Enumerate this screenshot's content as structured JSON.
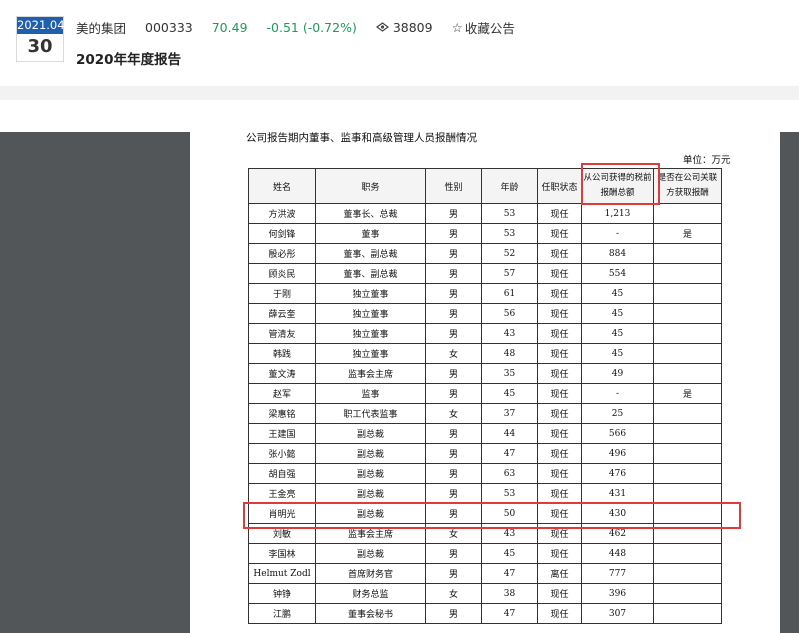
{
  "header": {
    "date_month": "2021.04",
    "date_day": "30",
    "company_name": "美的集团",
    "stock_code": "000333",
    "price": "70.49",
    "change": "-0.51 (-0.72%)",
    "views": "38809",
    "favorite_label": "收藏公告",
    "report_title": "2020年年度报告"
  },
  "document": {
    "caption": "公司报告期内董事、监事和高级管理人员报酬情况",
    "unit": "单位：万元",
    "columns": [
      "姓名",
      "职务",
      "性别",
      "年龄",
      "任职状态",
      "从公司获得的税前报酬总额",
      "是否在公司关联方获取报酬"
    ],
    "rows": [
      [
        "方洪波",
        "董事长、总裁",
        "男",
        "53",
        "现任",
        "1,213",
        ""
      ],
      [
        "何剑锋",
        "董事",
        "男",
        "53",
        "现任",
        "-",
        "是"
      ],
      [
        "殷必彤",
        "董事、副总裁",
        "男",
        "52",
        "现任",
        "884",
        ""
      ],
      [
        "顾炎民",
        "董事、副总裁",
        "男",
        "57",
        "现任",
        "554",
        ""
      ],
      [
        "于刚",
        "独立董事",
        "男",
        "61",
        "现任",
        "45",
        ""
      ],
      [
        "薛云奎",
        "独立董事",
        "男",
        "56",
        "现任",
        "45",
        ""
      ],
      [
        "管清友",
        "独立董事",
        "男",
        "43",
        "现任",
        "45",
        ""
      ],
      [
        "韩践",
        "独立董事",
        "女",
        "48",
        "现任",
        "45",
        ""
      ],
      [
        "董文涛",
        "监事会主席",
        "男",
        "35",
        "现任",
        "49",
        ""
      ],
      [
        "赵军",
        "监事",
        "男",
        "45",
        "现任",
        "-",
        "是"
      ],
      [
        "梁惠铭",
        "职工代表监事",
        "女",
        "37",
        "现任",
        "25",
        ""
      ],
      [
        "王建国",
        "副总裁",
        "男",
        "44",
        "现任",
        "566",
        ""
      ],
      [
        "张小懿",
        "副总裁",
        "男",
        "47",
        "现任",
        "496",
        ""
      ],
      [
        "胡自强",
        "副总裁",
        "男",
        "63",
        "现任",
        "476",
        ""
      ],
      [
        "王金亮",
        "副总裁",
        "男",
        "53",
        "现任",
        "431",
        ""
      ],
      [
        "肖明光",
        "副总裁",
        "男",
        "50",
        "现任",
        "430",
        ""
      ],
      [
        "刘敏",
        "监事会主席",
        "女",
        "43",
        "现任",
        "462",
        ""
      ],
      [
        "李国林",
        "副总裁",
        "男",
        "45",
        "现任",
        "448",
        ""
      ],
      [
        "Helmut Zodl",
        "首席财务官",
        "男",
        "47",
        "离任",
        "777",
        ""
      ],
      [
        "钟铮",
        "财务总监",
        "女",
        "38",
        "现任",
        "396",
        ""
      ],
      [
        "江鹏",
        "董事会秘书",
        "男",
        "47",
        "现任",
        "307",
        ""
      ]
    ]
  },
  "colors": {
    "highlight": "#e03a3a",
    "price_green": "#1e9a5a",
    "date_blue": "#1f5fae",
    "pdf_gray": "#525659"
  }
}
